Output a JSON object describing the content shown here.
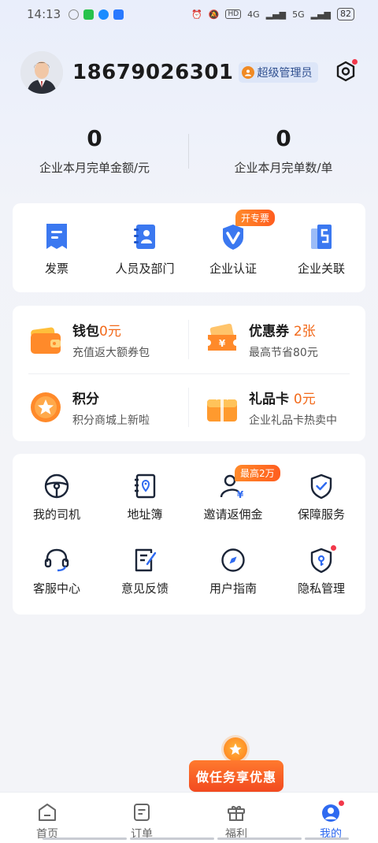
{
  "status_bar": {
    "time": "14:13",
    "network": "4G",
    "network2": "5G",
    "hd": "HD",
    "battery": "82"
  },
  "profile": {
    "phone": "18679026301",
    "role": "超级管理员"
  },
  "stats": [
    {
      "value": "0",
      "label": "企业本月完单金额/元"
    },
    {
      "value": "0",
      "label": "企业本月完单数/单"
    }
  ],
  "quick_actions": [
    {
      "label": "发票",
      "icon": "invoice-icon"
    },
    {
      "label": "人员及部门",
      "icon": "staff-icon"
    },
    {
      "label": "企业认证",
      "icon": "verify-icon",
      "tag": "开专票"
    },
    {
      "label": "企业关联",
      "icon": "link-company-icon"
    }
  ],
  "assets": {
    "wallet": {
      "title": "钱包",
      "value": "0元",
      "sub": "充值返大额券包"
    },
    "coupon": {
      "title": "优惠券",
      "value": "2张",
      "sub": "最高节省80元"
    },
    "points": {
      "title": "积分",
      "value": "",
      "sub": "积分商城上新啦"
    },
    "giftcard": {
      "title": "礼品卡",
      "value": "0元",
      "sub": "企业礼品卡热卖中"
    }
  },
  "services": [
    {
      "label": "我的司机",
      "icon": "steering-wheel-icon"
    },
    {
      "label": "地址簿",
      "icon": "address-book-icon"
    },
    {
      "label": "邀请返佣金",
      "icon": "invite-icon",
      "tag": "最高2万"
    },
    {
      "label": "保障服务",
      "icon": "shield-icon"
    },
    {
      "label": "客服中心",
      "icon": "headset-icon"
    },
    {
      "label": "意见反馈",
      "icon": "feedback-icon"
    },
    {
      "label": "用户指南",
      "icon": "compass-icon"
    },
    {
      "label": "隐私管理",
      "icon": "privacy-icon"
    }
  ],
  "promo": {
    "label": "做任务享优惠"
  },
  "tabs": [
    {
      "label": "首页",
      "icon": "home-icon"
    },
    {
      "label": "订单",
      "icon": "order-icon"
    },
    {
      "label": "福利",
      "icon": "gift-icon"
    },
    {
      "label": "我的",
      "icon": "profile-icon"
    }
  ],
  "colors": {
    "accent": "#2f6af0",
    "orange": "#f26a1b",
    "red_dot": "#f2384a"
  }
}
